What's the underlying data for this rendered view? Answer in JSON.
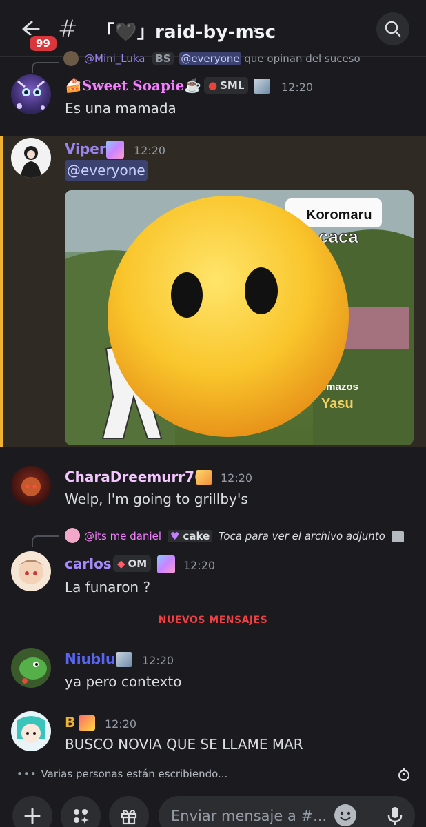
{
  "header": {
    "unread_badge": "99",
    "channel_name": "「🖤」raid-by-msc",
    "chevron": "›"
  },
  "messages": [
    {
      "reply": {
        "user": "@Mini_Luka",
        "tag": "BS",
        "text_mention": "@everyone",
        "text": " que opinan del suceso"
      },
      "username": "🍰Sweet Soapie☕",
      "tag": "SML",
      "time": "12:20",
      "text": "Es una mamada",
      "name_color": "#f47fff"
    },
    {
      "username": "Viper",
      "time": "12:20",
      "mention": "@everyone",
      "image_labels": {
        "label1": "Koromaru",
        "label2": "caca",
        "label3": "omazos",
        "label4": "Yasu"
      },
      "name_color": "#9b84ee"
    },
    {
      "username": "CharaDreemurr76",
      "time": "12:20",
      "text": "Welp, I'm going to grillby's",
      "name_color": "#f4c6ff"
    },
    {
      "reply": {
        "user": "@its me daniel",
        "tag": "cake",
        "text": "Toca para ver el archivo adjunto"
      },
      "username": "carlos",
      "tag": "OM",
      "time": "12:20",
      "text": "La funaron ?",
      "name_color": "#a78bfa"
    },
    {
      "username": "Niublu",
      "time": "12:20",
      "text": "ya pero contexto",
      "name_color": "#5865f2"
    },
    {
      "username": "B",
      "time": "12:20",
      "text": "BUSCO NOVIA QUE SE LLAME MAR",
      "name_color": "#f0b232"
    }
  ],
  "divider_label": "NUEVOS MENSAJES",
  "typing": "Varias personas están escribiendo...",
  "composer": {
    "placeholder": "Enviar mensaje a #..."
  },
  "icons": [
    "back-arrow-icon",
    "hash-icon",
    "search-icon",
    "plus-icon",
    "apps-icon",
    "gift-icon",
    "emoji-icon",
    "microphone-icon",
    "image-icon",
    "slowmode-icon"
  ],
  "colors": {
    "background": "#1b1b1f",
    "highlight": "#f0b232",
    "mention_bg": "#3c4270",
    "new_messages": "#f23f43"
  }
}
